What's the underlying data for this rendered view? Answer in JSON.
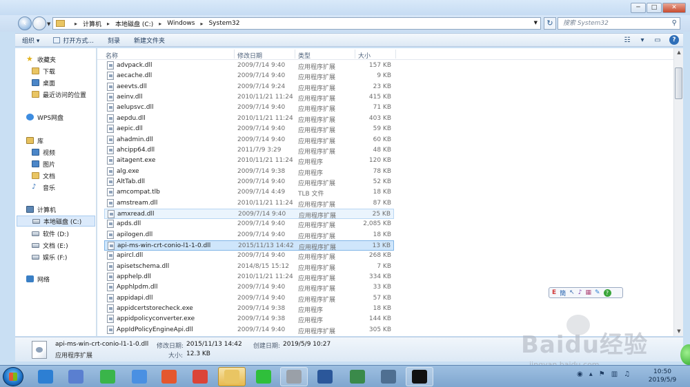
{
  "window": {
    "buttons": [
      "─",
      "□",
      "✕"
    ]
  },
  "address": {
    "crumbs": [
      "计算机",
      "本地磁盘 (C:)",
      "Windows",
      "System32"
    ],
    "search_placeholder": "搜索 System32"
  },
  "toolbar": {
    "organize": "组织 ▾",
    "open_with": "打开方式...",
    "burn": "刻录",
    "new_folder": "新建文件夹"
  },
  "nav": {
    "favorites": "收藏夹",
    "downloads": "下载",
    "desktop": "桌面",
    "recent": "最近访问的位置",
    "wps": "WPS网盘",
    "libraries": "库",
    "videos": "视频",
    "pictures": "图片",
    "documents": "文档",
    "music": "音乐",
    "computer": "计算机",
    "drive_c": "本地磁盘 (C:)",
    "drive_d": "软件 (D:)",
    "drive_e": "文档 (E:)",
    "drive_f": "娱乐 (F:)",
    "network": "网络"
  },
  "columns": {
    "name": "名称",
    "date": "修改日期",
    "type": "类型",
    "size": "大小"
  },
  "files": [
    {
      "name": "advpack.dll",
      "date": "2009/7/14 9:40",
      "type": "应用程序扩展",
      "size": "157 KB"
    },
    {
      "name": "aecache.dll",
      "date": "2009/7/14 9:40",
      "type": "应用程序扩展",
      "size": "9 KB"
    },
    {
      "name": "aeevts.dll",
      "date": "2009/7/14 9:24",
      "type": "应用程序扩展",
      "size": "23 KB"
    },
    {
      "name": "aeinv.dll",
      "date": "2010/11/21 11:24",
      "type": "应用程序扩展",
      "size": "415 KB"
    },
    {
      "name": "aelupsvc.dll",
      "date": "2009/7/14 9:40",
      "type": "应用程序扩展",
      "size": "71 KB"
    },
    {
      "name": "aepdu.dll",
      "date": "2010/11/21 11:24",
      "type": "应用程序扩展",
      "size": "403 KB"
    },
    {
      "name": "aepic.dll",
      "date": "2009/7/14 9:40",
      "type": "应用程序扩展",
      "size": "59 KB"
    },
    {
      "name": "ahadmin.dll",
      "date": "2009/7/14 9:40",
      "type": "应用程序扩展",
      "size": "60 KB"
    },
    {
      "name": "ahcipp64.dll",
      "date": "2011/7/9 3:29",
      "type": "应用程序扩展",
      "size": "48 KB"
    },
    {
      "name": "aitagent.exe",
      "date": "2010/11/21 11:24",
      "type": "应用程序",
      "size": "120 KB"
    },
    {
      "name": "alg.exe",
      "date": "2009/7/14 9:38",
      "type": "应用程序",
      "size": "78 KB"
    },
    {
      "name": "AltTab.dll",
      "date": "2009/7/14 9:40",
      "type": "应用程序扩展",
      "size": "52 KB"
    },
    {
      "name": "amcompat.tlb",
      "date": "2009/7/14 4:49",
      "type": "TLB 文件",
      "size": "18 KB"
    },
    {
      "name": "amstream.dll",
      "date": "2010/11/21 11:24",
      "type": "应用程序扩展",
      "size": "87 KB"
    },
    {
      "name": "amxread.dll",
      "date": "2009/7/14 9:40",
      "type": "应用程序扩展",
      "size": "25 KB"
    },
    {
      "name": "apds.dll",
      "date": "2009/7/14 9:40",
      "type": "应用程序扩展",
      "size": "2,085 KB"
    },
    {
      "name": "apilogen.dll",
      "date": "2009/7/14 9:40",
      "type": "应用程序扩展",
      "size": "18 KB"
    },
    {
      "name": "api-ms-win-crt-conio-l1-1-0.dll",
      "date": "2015/11/13 14:42",
      "type": "应用程序扩展",
      "size": "13 KB"
    },
    {
      "name": "apircl.dll",
      "date": "2009/7/14 9:40",
      "type": "应用程序扩展",
      "size": "268 KB"
    },
    {
      "name": "apisetschema.dll",
      "date": "2014/8/15 15:12",
      "type": "应用程序扩展",
      "size": "7 KB"
    },
    {
      "name": "apphelp.dll",
      "date": "2010/11/21 11:24",
      "type": "应用程序扩展",
      "size": "334 KB"
    },
    {
      "name": "Apphlpdm.dll",
      "date": "2009/7/14 9:40",
      "type": "应用程序扩展",
      "size": "33 KB"
    },
    {
      "name": "appidapi.dll",
      "date": "2009/7/14 9:40",
      "type": "应用程序扩展",
      "size": "57 KB"
    },
    {
      "name": "appidcertstorecheck.exe",
      "date": "2009/7/14 9:38",
      "type": "应用程序",
      "size": "18 KB"
    },
    {
      "name": "appidpolicyconverter.exe",
      "date": "2009/7/14 9:38",
      "type": "应用程序",
      "size": "144 KB"
    },
    {
      "name": "AppIdPolicyEngineApi.dll",
      "date": "2009/7/14 9:40",
      "type": "应用程序扩展",
      "size": "305 KB"
    }
  ],
  "selected_index": 17,
  "hover_index": 14,
  "details": {
    "name": "api-ms-win-crt-conio-l1-1-0.dll",
    "type": "应用程序扩展",
    "modified_label": "修改日期:",
    "modified_value": "2015/11/13 14:42",
    "created_label": "创建日期:",
    "created_value": "2019/5/9 10:27",
    "size_label": "大小:",
    "size_value": "12.3 KB"
  },
  "ime": {
    "symbols": [
      "E",
      "簡",
      "↖",
      "♪",
      "▦",
      "✎",
      "?"
    ]
  },
  "clock": {
    "time": "10:50",
    "date": "2019/5/9"
  },
  "watermark": {
    "text": "Baidu经验",
    "url": "jingyan.baidu.com"
  },
  "taskbar_apps": [
    {
      "name": "ie-icon",
      "color": "#2d7fd3",
      "state": "normal"
    },
    {
      "name": "feather-icon",
      "color": "#5a7fd0",
      "state": "normal"
    },
    {
      "name": "360-icon",
      "color": "#3ab54a",
      "state": "normal"
    },
    {
      "name": "baidu-netdisk-icon",
      "color": "#4a90e2",
      "state": "normal"
    },
    {
      "name": "app-grid-icon",
      "color": "#e4572e",
      "state": "normal"
    },
    {
      "name": "chrome-icon",
      "color": "#db4437",
      "state": "normal"
    },
    {
      "name": "explorer-icon",
      "color": "#e9c563",
      "state": "active"
    },
    {
      "name": "wechat-icon",
      "color": "#2fbf3b",
      "state": "normal"
    },
    {
      "name": "tool-icon",
      "color": "#9aa0a8",
      "state": "open"
    },
    {
      "name": "word-icon",
      "color": "#2b579a",
      "state": "normal"
    },
    {
      "name": "monitor-icon",
      "color": "#3a8a4a",
      "state": "normal"
    },
    {
      "name": "remote-icon",
      "color": "#4f6f91",
      "state": "normal"
    },
    {
      "name": "cmd-icon",
      "color": "#111111",
      "state": "open"
    }
  ]
}
